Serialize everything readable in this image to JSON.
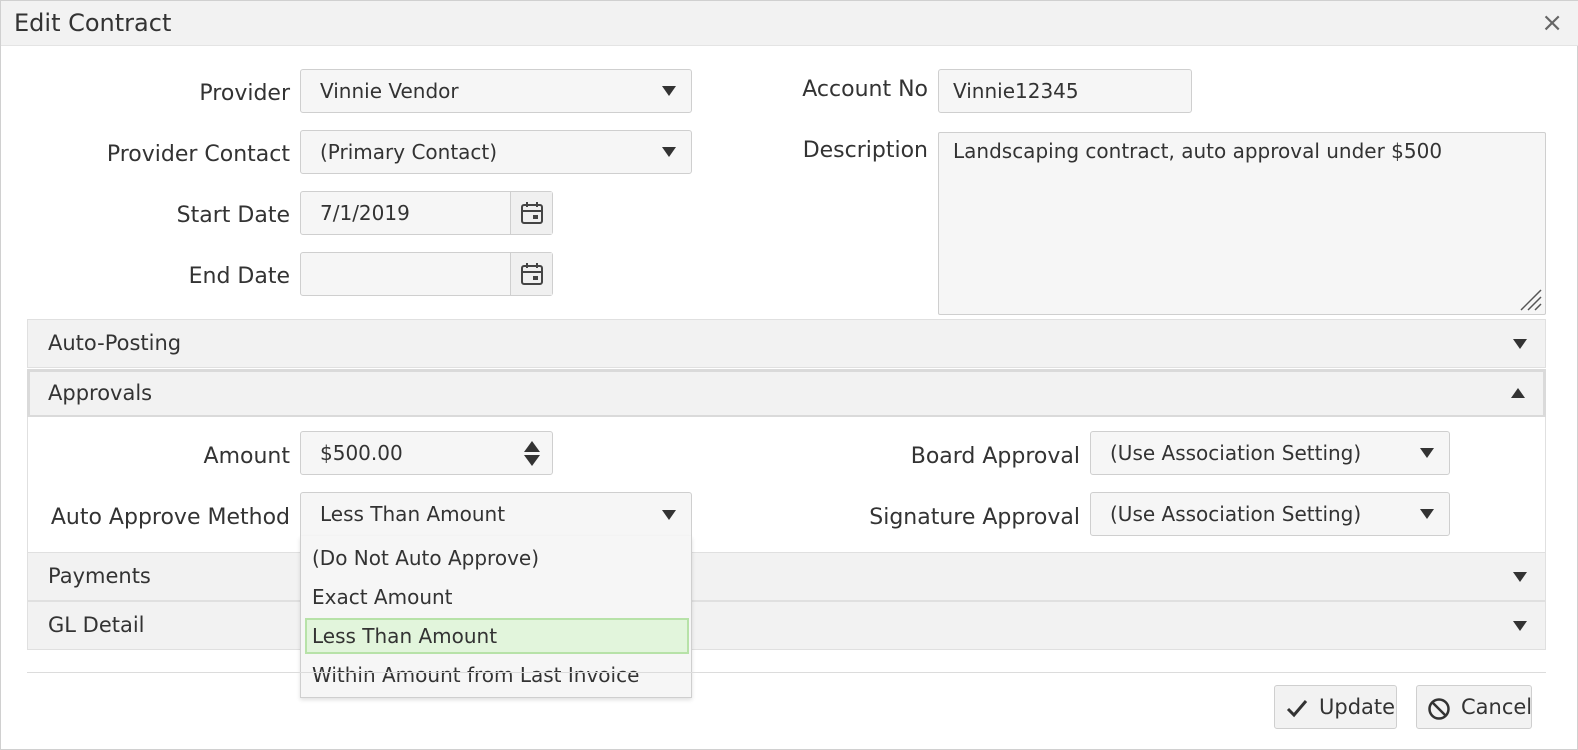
{
  "dialog": {
    "title": "Edit Contract",
    "close_glyph": "×"
  },
  "form": {
    "provider": {
      "label": "Provider",
      "value": "Vinnie Vendor"
    },
    "provider_contact": {
      "label": "Provider Contact",
      "value": "(Primary Contact)"
    },
    "start_date": {
      "label": "Start Date",
      "value": "7/1/2019"
    },
    "end_date": {
      "label": "End Date",
      "value": ""
    },
    "account_no": {
      "label": "Account No",
      "value": "Vinnie12345"
    },
    "description": {
      "label": "Description",
      "value": "Landscaping contract, auto approval under $500"
    }
  },
  "sections": {
    "auto_posting": "Auto-Posting",
    "approvals": "Approvals",
    "payments": "Payments",
    "gl_detail": "GL Detail"
  },
  "approvals": {
    "amount": {
      "label": "Amount",
      "value": "$500.00"
    },
    "auto_approve_method": {
      "label": "Auto Approve Method",
      "value": "Less Than Amount",
      "options": [
        "(Do Not Auto Approve)",
        "Exact Amount",
        "Less Than Amount",
        "Within Amount from Last Invoice"
      ],
      "selected_index": 2
    },
    "board_approval": {
      "label": "Board Approval",
      "value": "(Use Association Setting)"
    },
    "signature_approval": {
      "label": "Signature Approval",
      "value": "(Use Association Setting)"
    }
  },
  "footer": {
    "update_label": "Update",
    "cancel_label": "Cancel"
  },
  "icons": {
    "calendar": "calendar-icon",
    "check": "check-icon",
    "cancel": "ban-icon",
    "close": "close-icon"
  },
  "colors": {
    "selected_bg": "#e2f5dc",
    "selected_border": "#b7e2a8",
    "panel_bg": "#f2f2f2"
  }
}
